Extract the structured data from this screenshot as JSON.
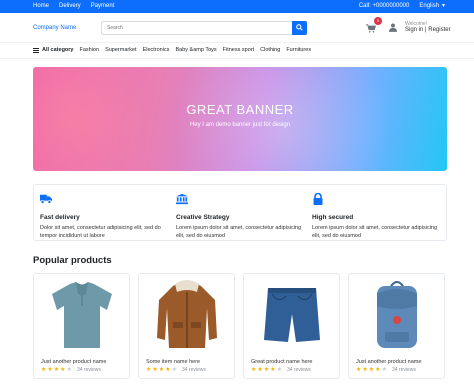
{
  "topbar": {
    "links": [
      "Home",
      "Delivery",
      "Payment"
    ],
    "phone": "Call: +0000000000",
    "language": "English"
  },
  "header": {
    "company": "Company Name",
    "search_placeholder": "Search",
    "cart_count": "0",
    "welcome": "Welcome!",
    "signin": "Sign in",
    "separator": "|",
    "register": "Register"
  },
  "categories": {
    "all_label": "All category",
    "items": [
      "Fashion",
      "Supermarket",
      "Electronics",
      "Baby &amp Toys",
      "Fitness sport",
      "Clothing",
      "Furnitures"
    ]
  },
  "banner": {
    "title": "GREAT BANNER",
    "subtitle": "Hey I am demo banner just for design"
  },
  "features": [
    {
      "title": "Fast delivery",
      "text": "Dolor sit amet, consectetur adipisicing elit, sed do tempor incididunt ut labore",
      "icon": "truck-icon"
    },
    {
      "title": "Creative Strategy",
      "text": "Lorem ipsum dolor sit amet, consectetur adipisicing elit, sed do eiusmod",
      "icon": "bank-icon"
    },
    {
      "title": "High secured",
      "text": "Lorem ipsum dolor sit amet, consectetur adipisicing elit, sed do eiusmod",
      "icon": "lock-icon"
    }
  ],
  "popular": {
    "title": "Popular products",
    "products": [
      {
        "name": "Just another product name",
        "rating": 4,
        "reviews": "34 reviews",
        "image": "polo-shirt"
      },
      {
        "name": "Some item name here",
        "rating": 4,
        "reviews": "34 reviews",
        "image": "jacket"
      },
      {
        "name": "Great product name here",
        "rating": 4,
        "reviews": "34 reviews",
        "image": "jeans-shorts"
      },
      {
        "name": "Just another product name",
        "rating": 4,
        "reviews": "34 reviews",
        "image": "backpack"
      }
    ]
  },
  "colors": {
    "primary": "#0d6efd",
    "badge": "#dc3545",
    "star": "#f5b301"
  }
}
